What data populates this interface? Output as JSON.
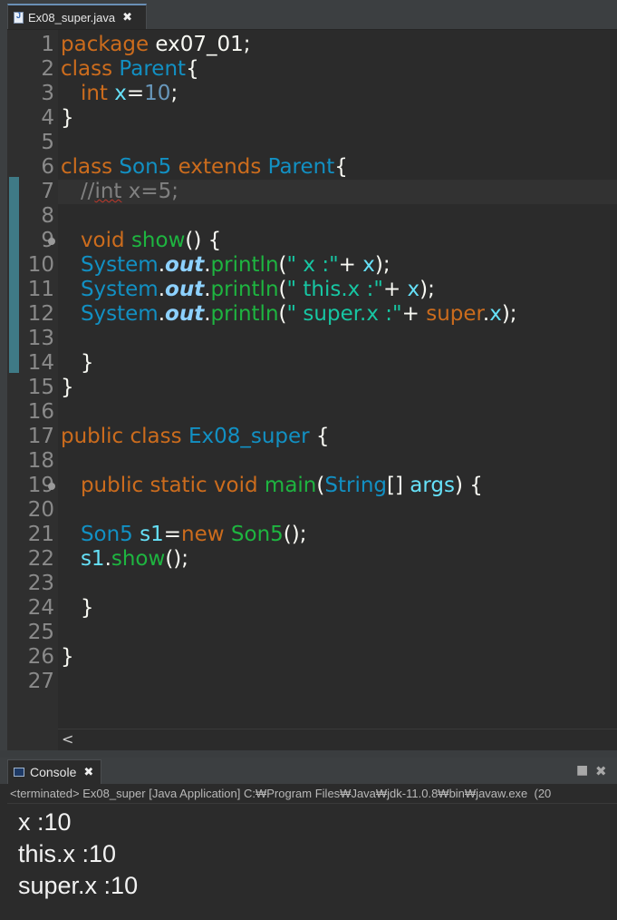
{
  "editor": {
    "tab": {
      "label": "Ex08_super.java",
      "close": "✖",
      "icon": "java-file-icon"
    },
    "line_numbers": [
      "1",
      "2",
      "3",
      "4",
      "5",
      "6",
      "7",
      "8",
      "9",
      "10",
      "11",
      "12",
      "13",
      "14",
      "15",
      "16",
      "17",
      "18",
      "19",
      "20",
      "21",
      "22",
      "23",
      "24",
      "25",
      "26",
      "27"
    ],
    "lines": [
      {
        "n": 1,
        "tokens": [
          [
            "kw",
            "package"
          ],
          [
            "pl",
            " ex07_01;"
          ]
        ]
      },
      {
        "n": 2,
        "tokens": [
          [
            "kw",
            "class"
          ],
          [
            "pl",
            " "
          ],
          [
            "ty",
            "Parent"
          ],
          [
            "pl",
            "{"
          ]
        ]
      },
      {
        "n": 3,
        "tokens": [
          [
            "pl",
            "   "
          ],
          [
            "kw",
            "int"
          ],
          [
            "pl",
            " "
          ],
          [
            "fd",
            "x"
          ],
          [
            "pl",
            "="
          ],
          [
            "num",
            "10"
          ],
          [
            "pl",
            ";"
          ]
        ]
      },
      {
        "n": 4,
        "tokens": [
          [
            "pl",
            "}"
          ]
        ]
      },
      {
        "n": 5,
        "tokens": []
      },
      {
        "n": 6,
        "tokens": [
          [
            "kw",
            "class"
          ],
          [
            "pl",
            " "
          ],
          [
            "ty",
            "Son5"
          ],
          [
            "pl",
            " "
          ],
          [
            "kw",
            "extends"
          ],
          [
            "pl",
            " "
          ],
          [
            "ty",
            "Parent"
          ],
          [
            "pl",
            "{"
          ]
        ]
      },
      {
        "n": 7,
        "tokens": [
          [
            "pl",
            "   "
          ],
          [
            "cm",
            "//"
          ],
          [
            "cmsq",
            "int"
          ],
          [
            "cm",
            " x=5;"
          ]
        ]
      },
      {
        "n": 8,
        "tokens": []
      },
      {
        "n": 9,
        "tokens": [
          [
            "pl",
            "   "
          ],
          [
            "kw",
            "void"
          ],
          [
            "pl",
            " "
          ],
          [
            "fn",
            "show"
          ],
          [
            "pl",
            "() {"
          ]
        ]
      },
      {
        "n": 10,
        "tokens": [
          [
            "pl",
            "   "
          ],
          [
            "ty",
            "System"
          ],
          [
            "pl",
            "."
          ],
          [
            "sf",
            "out"
          ],
          [
            "pl",
            "."
          ],
          [
            "fn",
            "println"
          ],
          [
            "pl",
            "("
          ],
          [
            "st",
            "\" x :\""
          ],
          [
            "pl",
            "+ "
          ],
          [
            "fd",
            "x"
          ],
          [
            "pl",
            ");"
          ]
        ]
      },
      {
        "n": 11,
        "tokens": [
          [
            "pl",
            "   "
          ],
          [
            "ty",
            "System"
          ],
          [
            "pl",
            "."
          ],
          [
            "sf",
            "out"
          ],
          [
            "pl",
            "."
          ],
          [
            "fn",
            "println"
          ],
          [
            "pl",
            "("
          ],
          [
            "st",
            "\" this.x :\""
          ],
          [
            "pl",
            "+ "
          ],
          [
            "fd",
            "x"
          ],
          [
            "pl",
            ");"
          ]
        ]
      },
      {
        "n": 12,
        "tokens": [
          [
            "pl",
            "   "
          ],
          [
            "ty",
            "System"
          ],
          [
            "pl",
            "."
          ],
          [
            "sf",
            "out"
          ],
          [
            "pl",
            "."
          ],
          [
            "fn",
            "println"
          ],
          [
            "pl",
            "("
          ],
          [
            "st",
            "\" super.x :\""
          ],
          [
            "pl",
            "+ "
          ],
          [
            "kw",
            "super"
          ],
          [
            "pl",
            "."
          ],
          [
            "fd",
            "x"
          ],
          [
            "pl",
            ");"
          ]
        ]
      },
      {
        "n": 13,
        "tokens": []
      },
      {
        "n": 14,
        "tokens": [
          [
            "pl",
            "   }"
          ]
        ]
      },
      {
        "n": 15,
        "tokens": [
          [
            "pl",
            "}"
          ]
        ]
      },
      {
        "n": 16,
        "tokens": []
      },
      {
        "n": 17,
        "tokens": [
          [
            "kw",
            "public"
          ],
          [
            "pl",
            " "
          ],
          [
            "kw",
            "class"
          ],
          [
            "pl",
            " "
          ],
          [
            "ty",
            "Ex08_super"
          ],
          [
            "pl",
            " {"
          ]
        ]
      },
      {
        "n": 18,
        "tokens": []
      },
      {
        "n": 19,
        "tokens": [
          [
            "pl",
            "   "
          ],
          [
            "kw",
            "public"
          ],
          [
            "pl",
            " "
          ],
          [
            "kw",
            "static"
          ],
          [
            "pl",
            " "
          ],
          [
            "kw",
            "void"
          ],
          [
            "pl",
            " "
          ],
          [
            "fn",
            "main"
          ],
          [
            "pl",
            "("
          ],
          [
            "ty",
            "String"
          ],
          [
            "pl",
            "[] "
          ],
          [
            "fd",
            "args"
          ],
          [
            "pl",
            ") {"
          ]
        ]
      },
      {
        "n": 20,
        "tokens": []
      },
      {
        "n": 21,
        "tokens": [
          [
            "pl",
            "   "
          ],
          [
            "ty",
            "Son5"
          ],
          [
            "pl",
            " "
          ],
          [
            "fd",
            "s1"
          ],
          [
            "pl",
            "="
          ],
          [
            "kw",
            "new"
          ],
          [
            "pl",
            " "
          ],
          [
            "fn",
            "Son5"
          ],
          [
            "pl",
            "();"
          ]
        ]
      },
      {
        "n": 22,
        "tokens": [
          [
            "pl",
            "   "
          ],
          [
            "fd",
            "s1"
          ],
          [
            "pl",
            "."
          ],
          [
            "fn",
            "show"
          ],
          [
            "pl",
            "();"
          ]
        ]
      },
      {
        "n": 23,
        "tokens": []
      },
      {
        "n": 24,
        "tokens": [
          [
            "pl",
            "   }"
          ]
        ]
      },
      {
        "n": 25,
        "tokens": []
      },
      {
        "n": 26,
        "tokens": [
          [
            "pl",
            "}"
          ]
        ]
      },
      {
        "n": 27,
        "tokens": []
      }
    ],
    "current_line": 7,
    "fold_lines": [
      9,
      19
    ],
    "changed_lines": [
      7,
      14
    ],
    "hscroll_arrow": "<"
  },
  "console": {
    "tab": {
      "label": "Console",
      "close": "✖",
      "icon": "console-icon"
    },
    "buttons": {
      "maximize": "■",
      "close": "✖"
    },
    "status": "<terminated> Ex08_super [Java Application] C:₩Program Files₩Java₩jdk-11.0.8₩bin₩javaw.exe  (20",
    "output": [
      "x :10",
      "this.x :10",
      "super.x :10"
    ]
  },
  "colors": {
    "keyword": "#cc6c1d",
    "type": "#1290c3",
    "method": "#1eb540",
    "string": "#17c6a3",
    "field": "#66e1f8",
    "number": "#6897bb",
    "static_field": "#8dd1ff",
    "comment": "#808080",
    "background": "#2b2b2b"
  }
}
